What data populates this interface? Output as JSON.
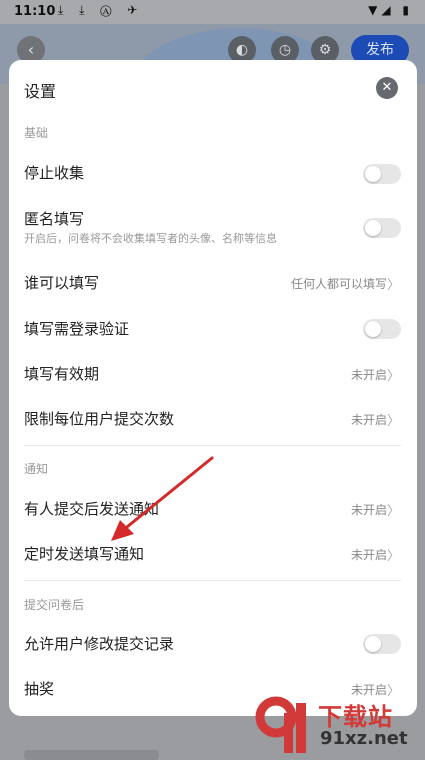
{
  "status_bar": {
    "time": "11:10",
    "icons": "⤓ ⤓ Ⓐ ✈",
    "right_icons": "▼◢ ▮"
  },
  "header": {
    "back_icon": "‹",
    "publish_label": "发布",
    "icons": [
      "palette-icon",
      "timer-icon",
      "gear-icon"
    ]
  },
  "settings": {
    "title": "设置",
    "close_icon": "✕",
    "sections": {
      "basic": "基础",
      "notify": "通知",
      "after_submit": "提交问卷后"
    },
    "rows": {
      "stop_collect": {
        "label": "停止收集",
        "toggle": false
      },
      "anonymous": {
        "label": "匿名填写",
        "sub": "开启后，问卷将不会收集填写者的头像、名称等信息",
        "toggle": false
      },
      "who_can_fill": {
        "label": "谁可以填写",
        "value": "任何人都可以填写"
      },
      "login_verify": {
        "label": "填写需登录验证",
        "toggle": false
      },
      "validity": {
        "label": "填写有效期",
        "value": "未开启"
      },
      "limit_per_user": {
        "label": "限制每位用户提交次数",
        "value": "未开启"
      },
      "notify_on_submit": {
        "label": "有人提交后发送通知",
        "value": "未开启"
      },
      "scheduled_notify": {
        "label": "定时发送填写通知",
        "value": "未开启"
      },
      "allow_modify": {
        "label": "允许用户修改提交记录",
        "toggle": false
      },
      "lottery": {
        "label": "抽奖",
        "value": "未开启"
      }
    }
  },
  "watermark": {
    "site": "下载站",
    "url": "91xz.net"
  },
  "colors": {
    "accent": "#1d4bb5",
    "annotation_arrow": "#d42a2a"
  }
}
